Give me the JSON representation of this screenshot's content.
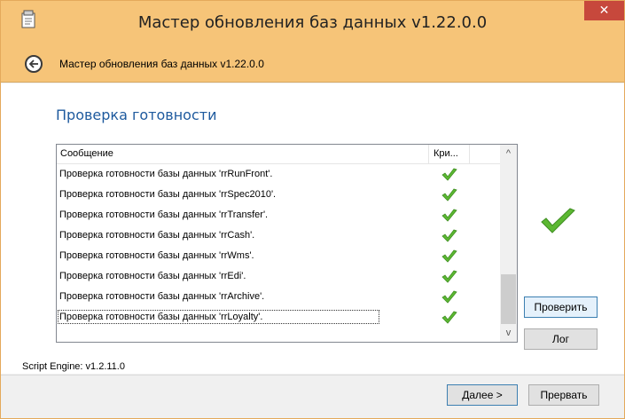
{
  "window": {
    "title": "Мастер обновления баз данных v1.22.0.0",
    "close_symbol": "✕"
  },
  "nav": {
    "title": "Мастер обновления баз данных v1.22.0.0"
  },
  "page": {
    "heading": "Проверка готовности"
  },
  "list": {
    "columns": {
      "message": "Сообщение",
      "critical": "Кри..."
    },
    "rows": [
      {
        "message": "Проверка готовности базы данных 'rrRunFront'.",
        "status_icon": "check-icon"
      },
      {
        "message": "Проверка готовности базы данных 'rrSpec2010'.",
        "status_icon": "check-icon"
      },
      {
        "message": "Проверка готовности базы данных 'rrTransfer'.",
        "status_icon": "check-icon"
      },
      {
        "message": "Проверка готовности базы данных 'rrCash'.",
        "status_icon": "check-icon"
      },
      {
        "message": "Проверка готовности базы данных 'rrWms'.",
        "status_icon": "check-icon"
      },
      {
        "message": "Проверка готовности базы данных 'rrEdi'.",
        "status_icon": "check-icon"
      },
      {
        "message": "Проверка готовности базы данных 'rrArchive'.",
        "status_icon": "check-icon"
      },
      {
        "message": "Проверка готовности базы данных 'rrLoyalty'.",
        "status_icon": "check-icon"
      }
    ],
    "scroll_up": "^",
    "scroll_down": "v"
  },
  "buttons": {
    "verify": "Проверить",
    "log": "Лог",
    "next_hotkey": "Д",
    "next_rest": "алее >",
    "cancel": "Прервать"
  },
  "status": {
    "script_engine": "Script Engine: v1.2.11.0"
  },
  "colors": {
    "title_bar": "#f6c478",
    "close_button": "#c7483c",
    "heading": "#1e5a9e",
    "check": "#5cb832"
  }
}
